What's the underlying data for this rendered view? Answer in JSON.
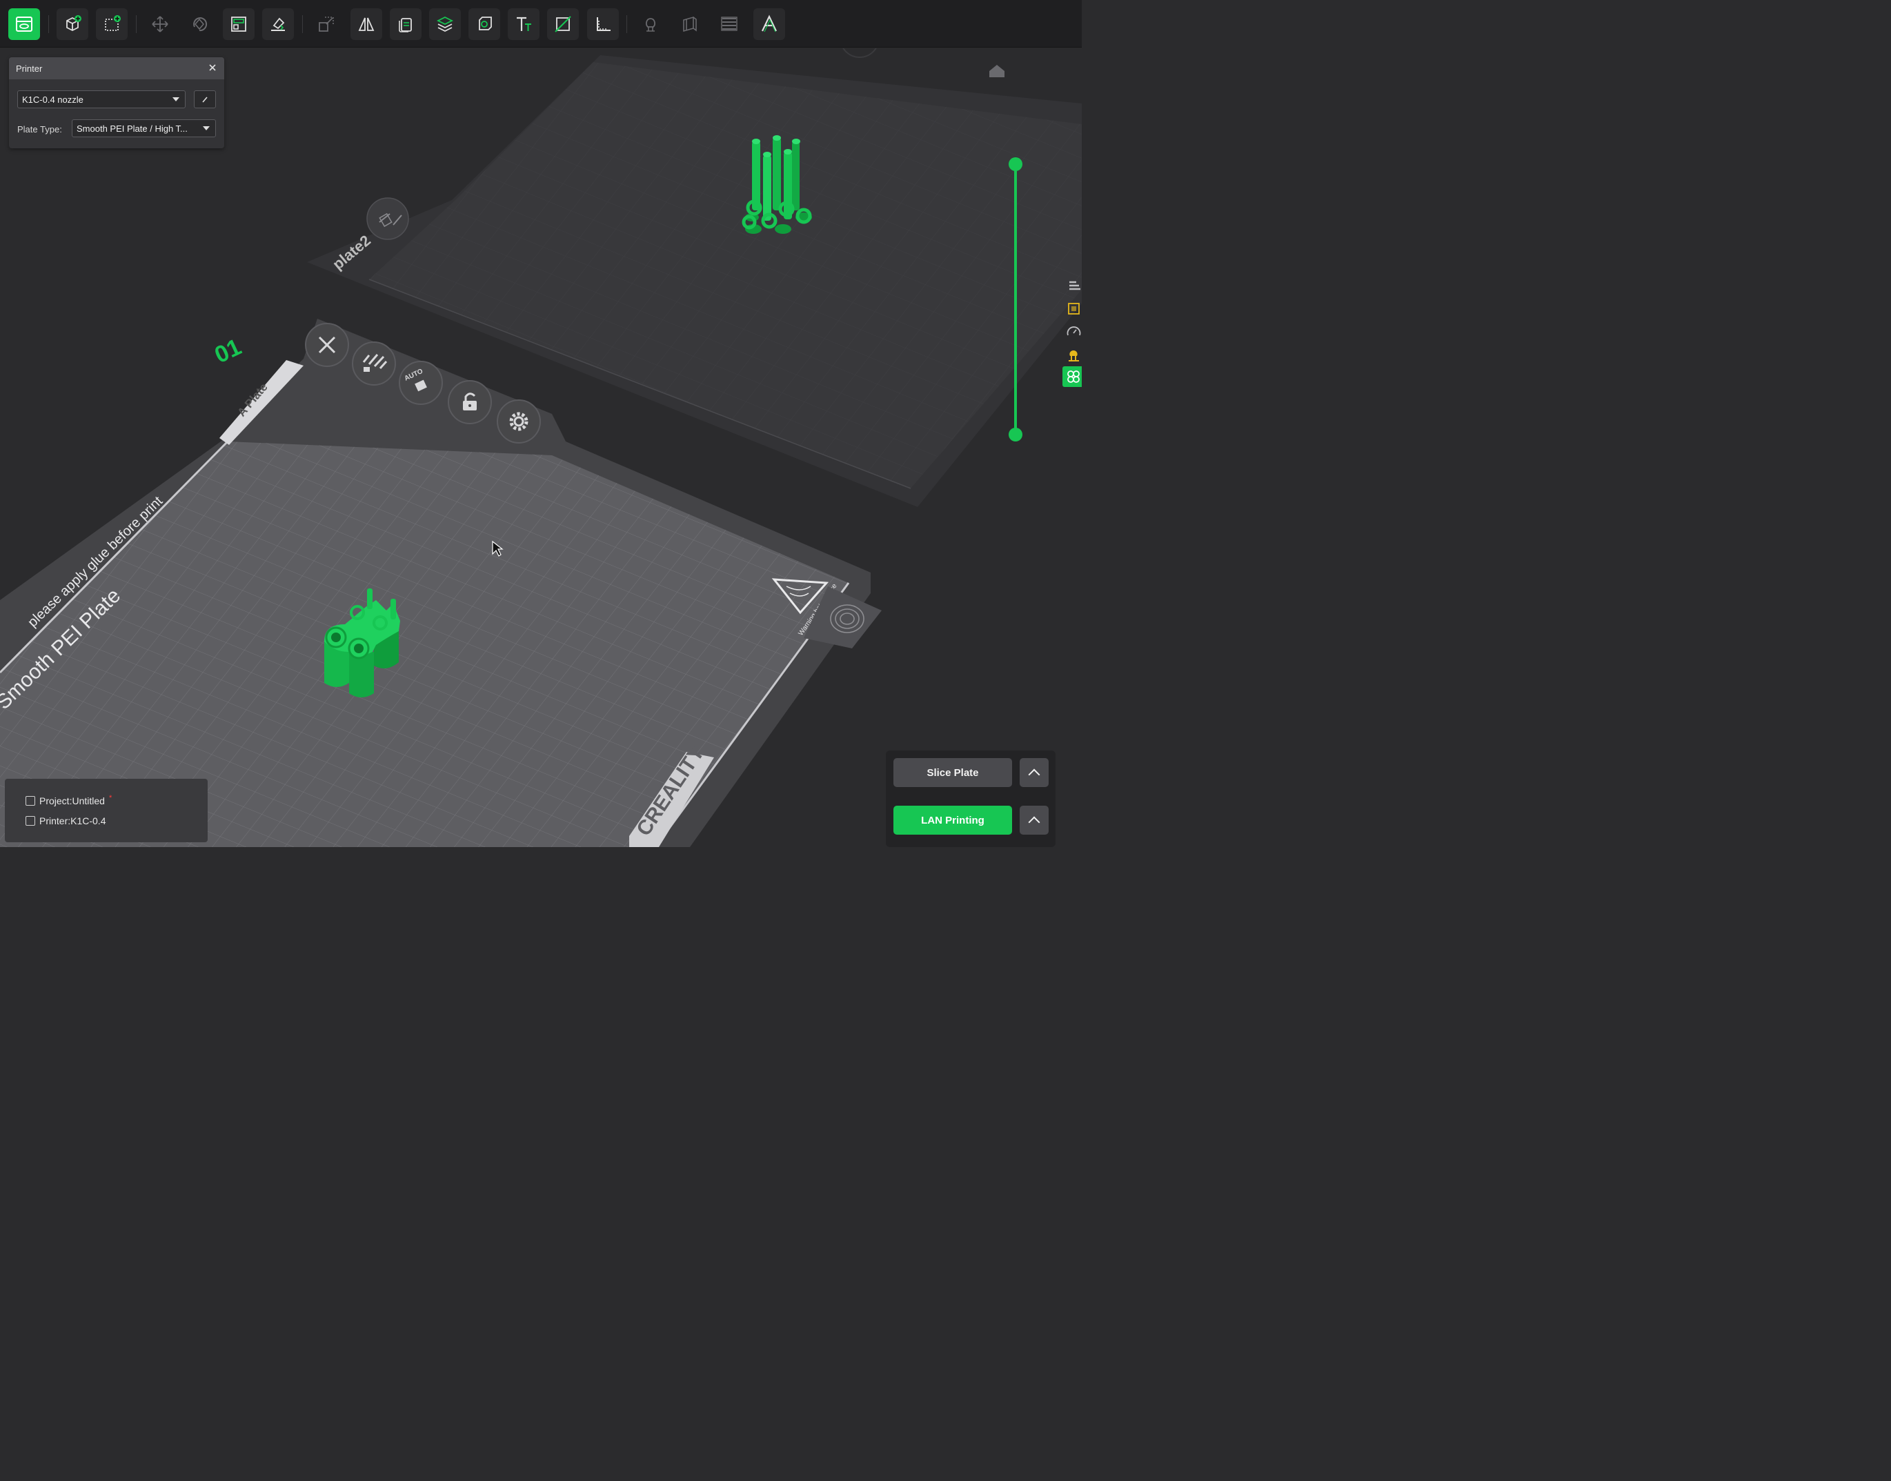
{
  "toolbar": {
    "tools": [
      {
        "name": "prepare-view-icon",
        "active": true
      },
      {
        "name": "add-object-icon"
      },
      {
        "name": "add-plate-icon"
      },
      {
        "name": "move-icon"
      },
      {
        "name": "rotate-icon"
      },
      {
        "name": "arrange-icon"
      },
      {
        "name": "lay-on-face-icon"
      },
      {
        "name": "scale-icon"
      },
      {
        "name": "mirror-icon"
      },
      {
        "name": "copy-icon"
      },
      {
        "name": "layers-icon"
      },
      {
        "name": "hollow-icon"
      },
      {
        "name": "text-icon"
      },
      {
        "name": "cut-icon"
      },
      {
        "name": "measure-icon"
      },
      {
        "name": "support-paint-icon"
      },
      {
        "name": "seam-paint-icon"
      },
      {
        "name": "variable-layer-icon"
      },
      {
        "name": "emboss-text-icon"
      }
    ]
  },
  "printer_panel": {
    "title": "Printer",
    "printer_value": "K1C-0.4 nozzle",
    "plate_type_label": "Plate Type:",
    "plate_type_value": "Smooth PEI Plate / High T..."
  },
  "plate1": {
    "number": "01",
    "tab_label": "A Plate",
    "bed_text_glue": "please apply glue before print",
    "bed_text_plate": "Smooth PEI Plate",
    "bed_brand": "CREALITY",
    "warning_text": "Warning hot surface",
    "auto_label": "AUTO"
  },
  "plate2": {
    "label": "plate2"
  },
  "status": {
    "project_label": "Project:Untitled",
    "modified_marker": "*",
    "printer_label": "Printer:K1C-0.4"
  },
  "actions": {
    "slice_label": "Slice Plate",
    "lan_label": "LAN Printing"
  },
  "colors": {
    "accent": "#17c653",
    "background": "#2b2b2d",
    "bed": "#5e5e62",
    "toolbar": "#1f1f21"
  }
}
